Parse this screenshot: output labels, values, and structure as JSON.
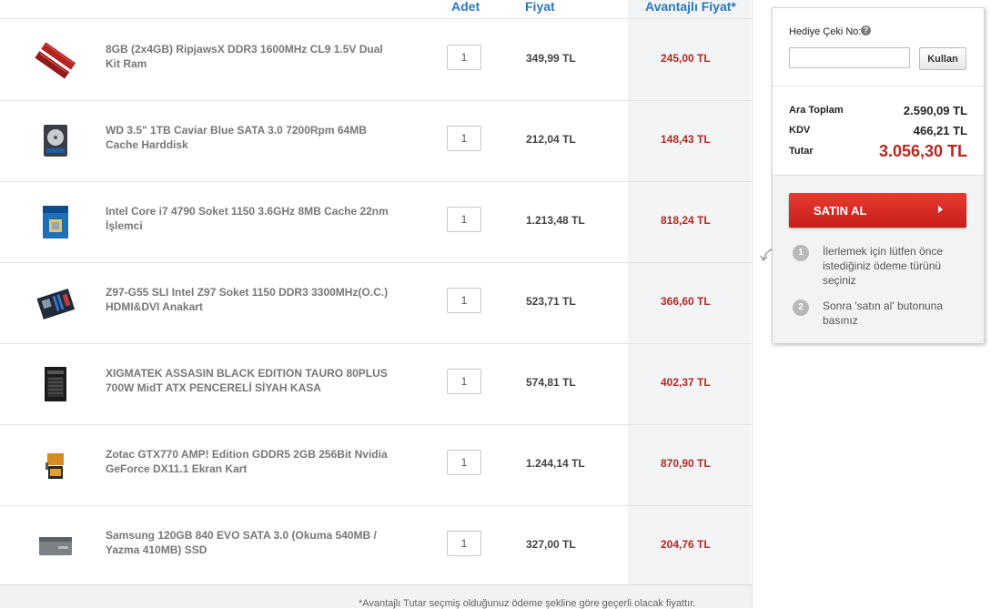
{
  "table": {
    "headers": {
      "qty": "Adet",
      "price": "Fiyat",
      "advantaged_price": "Avantajlı Fiyat*"
    },
    "rows": [
      {
        "name": "8GB (2x4GB) RipjawsX DDR3 1600MHz CL9 1.5V Dual Kit Ram",
        "qty": "1",
        "price": "349,99 TL",
        "advantaged_price": "245,00 TL",
        "thumb": "ram-icon"
      },
      {
        "name": "WD 3.5\" 1TB Caviar Blue SATA 3.0 7200Rpm 64MB Cache Harddisk",
        "qty": "1",
        "price": "212,04 TL",
        "advantaged_price": "148,43 TL",
        "thumb": "harddisk-icon"
      },
      {
        "name": "Intel Core i7 4790 Soket 1150 3.6GHz 8MB Cache 22nm İşlemci",
        "qty": "1",
        "price": "1.213,48 TL",
        "advantaged_price": "818,24 TL",
        "thumb": "cpu-box-icon"
      },
      {
        "name": "Z97-G55 SLI Intel Z97 Soket 1150 DDR3 3300MHz(O.C.) HDMI&DVI Anakart",
        "qty": "1",
        "price": "523,71 TL",
        "advantaged_price": "366,60 TL",
        "thumb": "motherboard-icon"
      },
      {
        "name": "XIGMATEK ASSASIN BLACK EDITION TAURO 80PLUS 700W MidT ATX PENCERELİ SİYAH KASA",
        "qty": "1",
        "price": "574,81 TL",
        "advantaged_price": "402,37 TL",
        "thumb": "pc-case-icon"
      },
      {
        "name": "Zotac GTX770 AMP! Edition GDDR5 2GB 256Bit Nvidia GeForce DX11.1 Ekran Kart",
        "qty": "1",
        "price": "1.244,14 TL",
        "advantaged_price": "870,90 TL",
        "thumb": "graphics-card-icon"
      },
      {
        "name": "Samsung 120GB 840 EVO SATA 3.0 (Okuma 540MB / Yazma 410MB) SSD",
        "qty": "1",
        "price": "327,00 TL",
        "advantaged_price": "204,76 TL",
        "thumb": "ssd-icon"
      }
    ],
    "footnote": "*Avantajlı Tutar seçmiş olduğunuz ödeme şekline göre geçerli olacak fiyattır."
  },
  "summary": {
    "gift_label": "Hediye Çeki No:",
    "help_icon": "?",
    "gift_input_value": "",
    "use_button": "Kullan",
    "subtotal_label": "Ara Toplam",
    "subtotal_value": "2.590,09 TL",
    "vat_label": "KDV",
    "vat_value": "466,21 TL",
    "total_label": "Tutar",
    "total_value": "3.056,30 TL",
    "buy_button": "SATIN AL",
    "steps": [
      {
        "num": "1",
        "text": "İlerlemek için lütfen önce istediğiniz ödeme türünü seçiniz"
      },
      {
        "num": "2",
        "text": "Sonra 'satın al' butonuna basınız"
      }
    ]
  },
  "colors": {
    "header_blue": "#2b78c2",
    "price_red": "#b22a23",
    "buy_red": "#d42a23"
  }
}
